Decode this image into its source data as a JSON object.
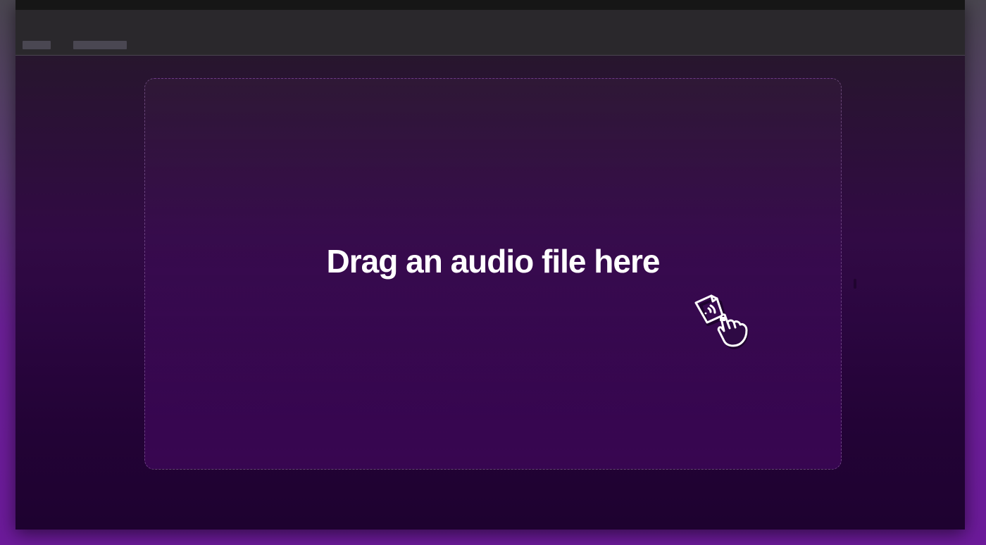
{
  "dropzone": {
    "label": "Drag an audio file here",
    "icon": "drag-file-hand-icon"
  },
  "colors": {
    "accent": "#6c1a9a",
    "text": "#ffffff",
    "toolbar": "#2a282c",
    "titlebar": "#161616"
  }
}
